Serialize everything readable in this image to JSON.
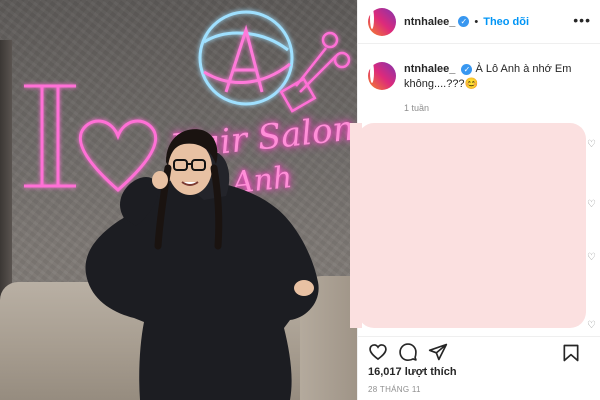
{
  "post": {
    "username": "ntnhalee_",
    "follow_label": "Theo dõi",
    "caption": "À Lô Anh à nhớ Em không....???😊",
    "time_ago": "1 tuần",
    "likes": "16,017 lượt thích",
    "date": "28 THÁNG 11"
  },
  "photo": {
    "neon_line_1": "Hair Salon",
    "neon_line_2": "Anh",
    "neon_logo_letter": "A",
    "neon_letter_i": "I"
  },
  "icons": {
    "verified": "verified-badge-icon",
    "more": "more-options-icon",
    "like": "heart-icon",
    "comment": "comment-icon",
    "share": "share-icon",
    "save": "bookmark-icon",
    "comment_like": "small-heart-icon"
  },
  "colors": {
    "follow": "#0095f6",
    "verified": "#3897f0",
    "neon_pink": "#ff5fd2",
    "neon_blue": "#8fd8ff",
    "blur_box": "#fbe0e0"
  }
}
